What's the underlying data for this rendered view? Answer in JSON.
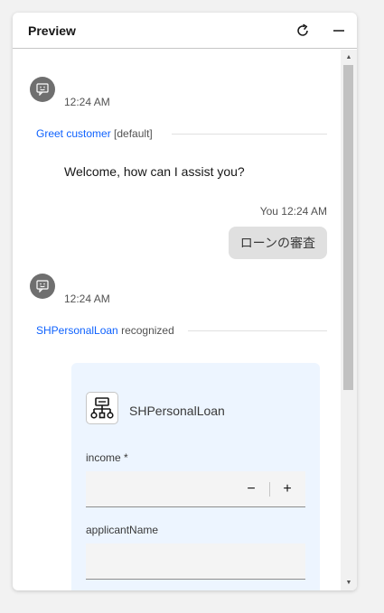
{
  "header": {
    "title": "Preview"
  },
  "messages": [
    {
      "sender": "assistant",
      "time": "12:24 AM",
      "divider_link": "Greet customer",
      "divider_text": " [default]",
      "text": "Welcome, how can I assist you?"
    },
    {
      "sender": "user",
      "time_label": "You 12:24 AM",
      "text": "ローンの審査"
    },
    {
      "sender": "assistant",
      "time": "12:24 AM",
      "divider_link": "SHPersonalLoan",
      "divider_text": " recognized"
    }
  ],
  "card": {
    "title": "SHPersonalLoan",
    "icon": "flow-diagram-icon",
    "fields": [
      {
        "label": "income *",
        "value": "",
        "decrement": "−",
        "increment": "+"
      },
      {
        "label": "applicantName",
        "value": ""
      }
    ]
  },
  "colors": {
    "link": "#0f62fe",
    "card_bg": "#edf5ff",
    "avatar_bg": "#6f6f6f",
    "bubble_bg": "#e0e0e0"
  }
}
